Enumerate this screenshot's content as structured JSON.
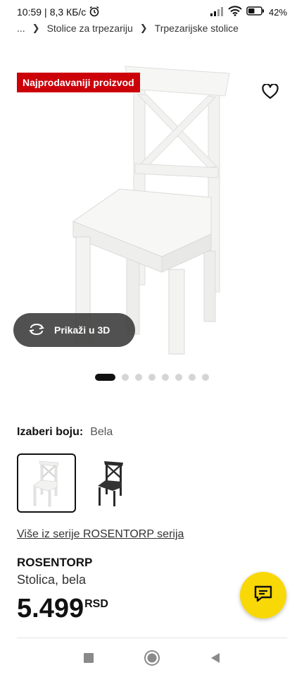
{
  "status_bar": {
    "time": "10:59",
    "net_speed": "8,3 КБ/с",
    "battery": "42"
  },
  "breadcrumb": {
    "ellipsis": "...",
    "items": [
      "Stolice za trpezariju",
      "Trpezarijske stolice"
    ]
  },
  "product_gallery": {
    "badge": "Najprodavaniji proizvod",
    "view_3d_label": "Prikaži u 3D",
    "image_count": 8,
    "active_image": 1
  },
  "color_picker": {
    "label": "Izaberi boju:",
    "selected_value": "Bela",
    "options": [
      {
        "name": "white-chair-option",
        "color": "#f4f4f4",
        "selected": true
      },
      {
        "name": "black-chair-option",
        "color": "#2b2b2b",
        "selected": false
      }
    ]
  },
  "series_link": "Više iz serije ROSENTORP serija",
  "product": {
    "name": "ROSENTORP",
    "description": "Stolica, bela",
    "price": "5.499",
    "currency": "RSD"
  },
  "colors": {
    "badge_red": "#cc0008",
    "chat_yellow": "#f9d808",
    "pill_dark": "#323232"
  },
  "icons": [
    "alarm-icon",
    "signal-icon",
    "wifi-icon",
    "battery-icon",
    "chevron-right-icon",
    "heart-icon",
    "rotate-3d-icon",
    "chat-icon",
    "nav-square-icon",
    "nav-home-icon",
    "nav-back-icon"
  ]
}
